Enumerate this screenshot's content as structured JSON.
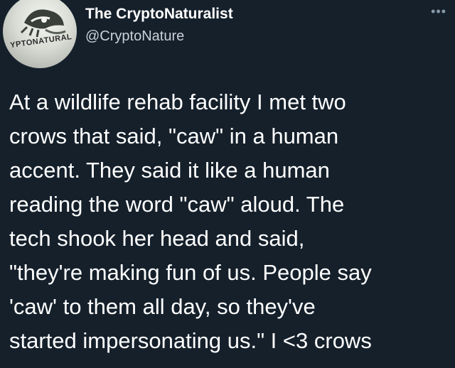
{
  "tweet": {
    "author": {
      "display_name": "The CryptoNaturalist",
      "handle": "@CryptoNature",
      "avatar_ring_text": "YPTONATURAL"
    },
    "more_icon": "more-dots-icon",
    "text": "At a wildlife rehab facility I met two\ncrows that said, \"caw\" in a human\naccent. They said it like a human\nreading the word \"caw\" aloud. The\ntech shook her head and said,\n\"they're making fun of us. People say\n'caw' to them all day, so they've\nstarted impersonating us.\" I <3 crows"
  },
  "colors": {
    "background": "#15202b",
    "text": "#ffffff",
    "secondary_text": "#c9d1d9"
  }
}
